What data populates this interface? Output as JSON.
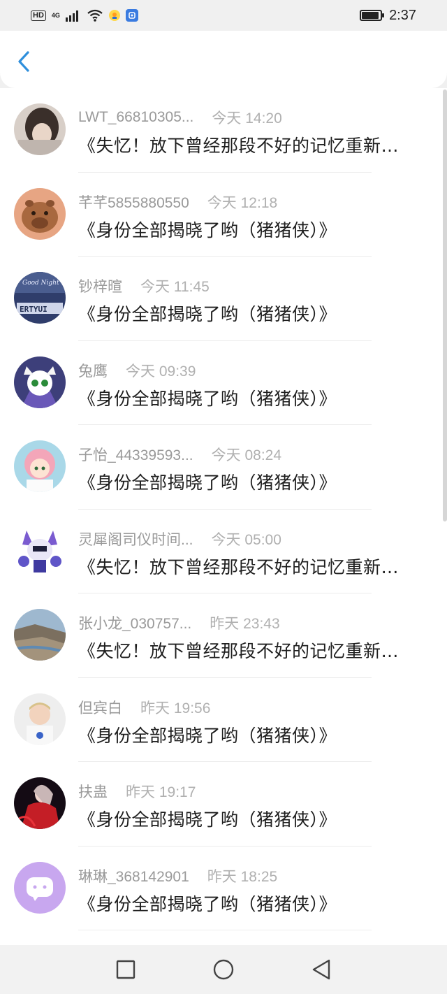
{
  "status_bar": {
    "hd": "HD",
    "network": "4G",
    "time": "2:37",
    "battery_level": 0.85,
    "icons": [
      "signal-icon",
      "wifi-icon",
      "app-notify-icon",
      "app-notify-icon-2",
      "battery-icon"
    ]
  },
  "header": {
    "back_icon": "chevron-left-icon",
    "accent_color": "#2f8fdc"
  },
  "comments": [
    {
      "user": "LWT_66810305...",
      "time": "今天 14:20",
      "text": "《失忆！放下曾经那段不好的记忆重新…",
      "avatar": "photo-girl"
    },
    {
      "user": "芊芊5855880550",
      "time": "今天 12:18",
      "text": "《身份全部揭晓了哟（猪猪侠）》",
      "avatar": "capybara"
    },
    {
      "user": "钞梓暄",
      "time": "今天 11:45",
      "text": "《身份全部揭晓了哟（猪猪侠）》",
      "avatar": "good-night-keyboard"
    },
    {
      "user": "兔鹰",
      "time": "今天 09:39",
      "text": "《身份全部揭晓了哟（猪猪侠）》",
      "avatar": "anime-robot"
    },
    {
      "user": "子怡_44339593...",
      "time": "今天 08:24",
      "text": "《身份全部揭晓了哟（猪猪侠）》",
      "avatar": "anime-girl-pink"
    },
    {
      "user": "灵犀阁司仪时间...",
      "time": "今天 05:00",
      "text": "《失忆！放下曾经那段不好的记忆重新…",
      "avatar": "cartoon-cat"
    },
    {
      "user": "张小龙_030757...",
      "time": "昨天 23:43",
      "text": "《失忆！放下曾经那段不好的记忆重新…",
      "avatar": "landscape"
    },
    {
      "user": "但宾白",
      "time": "昨天 19:56",
      "text": "《身份全部揭晓了哟（猪猪侠）》",
      "avatar": "child-photo"
    },
    {
      "user": "扶蛊",
      "time": "昨天 19:17",
      "text": "《身份全部揭晓了哟（猪猪侠）》",
      "avatar": "red-dress"
    },
    {
      "user": "琳琳_368142901",
      "time": "昨天 18:25",
      "text": "《身份全部揭晓了哟（猪猪侠）》",
      "avatar": "default-chat"
    }
  ],
  "nav_bar": {
    "recents_icon": "square-icon",
    "home_icon": "circle-icon",
    "back_icon": "triangle-back-icon"
  }
}
